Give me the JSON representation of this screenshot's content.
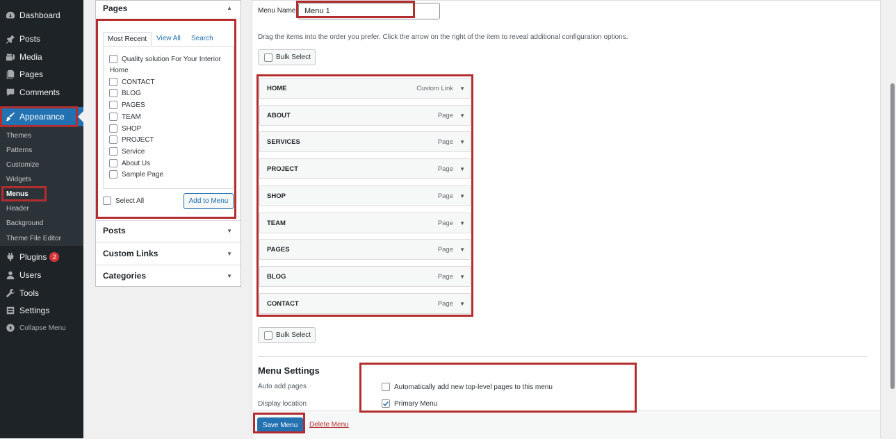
{
  "sidebar": {
    "items": [
      {
        "label": "Dashboard",
        "icon": "dashboard-icon"
      },
      {
        "label": "Posts",
        "icon": "pin-icon"
      },
      {
        "label": "Media",
        "icon": "media-icon"
      },
      {
        "label": "Pages",
        "icon": "pages-icon"
      },
      {
        "label": "Comments",
        "icon": "comments-icon"
      },
      {
        "label": "Appearance",
        "icon": "brush-icon"
      },
      {
        "label": "Plugins",
        "icon": "plugin-icon",
        "badge": "2"
      },
      {
        "label": "Users",
        "icon": "user-icon"
      },
      {
        "label": "Tools",
        "icon": "wrench-icon"
      },
      {
        "label": "Settings",
        "icon": "settings-icon"
      }
    ],
    "submenu": [
      "Themes",
      "Patterns",
      "Customize",
      "Widgets",
      "Menus",
      "Header",
      "Background",
      "Theme File Editor"
    ],
    "collapse_label": "Collapse Menu"
  },
  "accordion": {
    "pages_title": "Pages",
    "tabs": [
      "Most Recent",
      "View All",
      "Search"
    ],
    "pages": [
      "Quality solution For Your Interior",
      "Home",
      "CONTACT",
      "BLOG",
      "PAGES",
      "TEAM",
      "SHOP",
      "PROJECT",
      "Service",
      "About Us",
      "Sample Page"
    ],
    "select_all": "Select All",
    "add_to_menu": "Add to Menu",
    "sections": [
      "Posts",
      "Custom Links",
      "Categories"
    ]
  },
  "main": {
    "menu_name_label": "Menu Name",
    "menu_name_value": "Menu 1",
    "instructions": "Drag the items into the order you prefer. Click the arrow on the right of the item to reveal additional configuration options.",
    "bulk_select": "Bulk Select",
    "menu_items": [
      {
        "title": "HOME",
        "type": "Custom Link"
      },
      {
        "title": "ABOUT",
        "type": "Page"
      },
      {
        "title": "SERVICES",
        "type": "Page"
      },
      {
        "title": "PROJECT",
        "type": "Page"
      },
      {
        "title": "SHOP",
        "type": "Page"
      },
      {
        "title": "TEAM",
        "type": "Page"
      },
      {
        "title": "PAGES",
        "type": "Page"
      },
      {
        "title": "BLOG",
        "type": "Page"
      },
      {
        "title": "CONTACT",
        "type": "Page"
      }
    ],
    "settings_title": "Menu Settings",
    "auto_add_label": "Auto add pages",
    "auto_add_option": "Automatically add new top-level pages to this menu",
    "display_location_label": "Display location",
    "primary_menu_option": "Primary Menu",
    "save_button": "Save Menu",
    "delete_link": "Delete Menu"
  },
  "colors": {
    "accent": "#2271b1",
    "sidebar": "#1d2327",
    "annotation": "#b32d2e"
  }
}
